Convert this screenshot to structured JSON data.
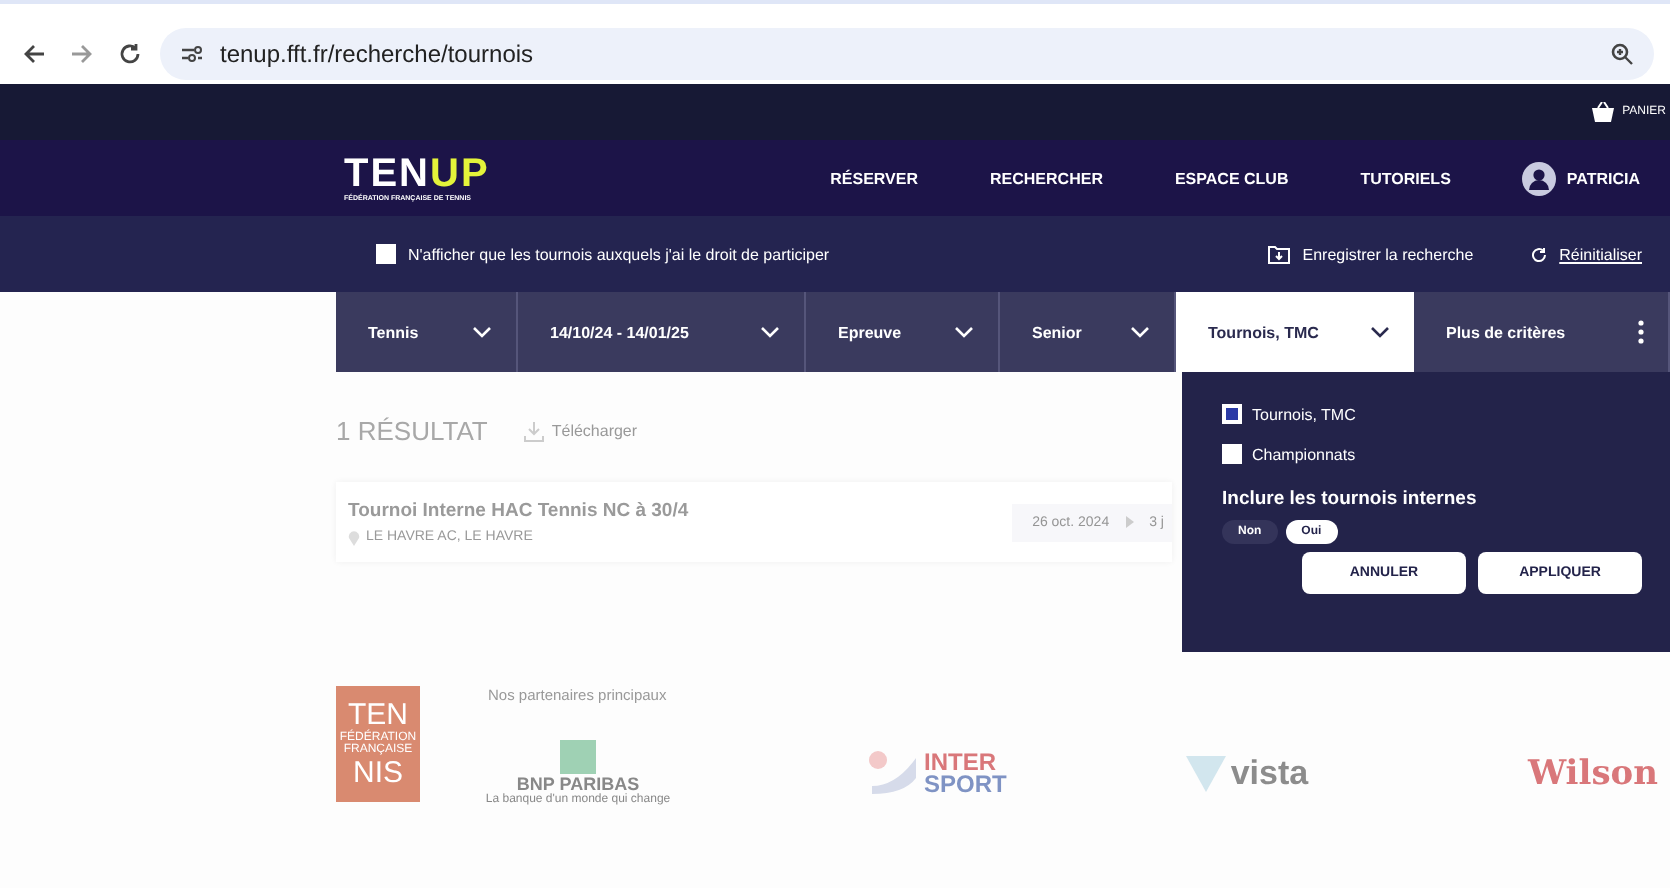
{
  "browser": {
    "url": "tenup.fft.fr/recherche/tournois"
  },
  "top_bar": {
    "cart_label": "PANIER"
  },
  "nav": {
    "logo_left": "TEN",
    "logo_right": "UP",
    "logo_subtitle": "FÉDÉRATION FRANÇAISE DE TENNIS",
    "items": [
      "RÉSERVER",
      "RECHERCHER",
      "ESPACE CLUB",
      "TUTORIELS"
    ],
    "user": "PATRICIA"
  },
  "subbar": {
    "checkbox_label": "N'afficher que les tournois auxquels j'ai le droit de participer",
    "checked": false,
    "save_label": "Enregistrer la recherche",
    "reset_label": "Réinitialiser"
  },
  "filters": [
    {
      "label": "Tennis",
      "selected": false
    },
    {
      "label": "14/10/24 - 14/01/25",
      "selected": false
    },
    {
      "label": "Epreuve",
      "selected": false
    },
    {
      "label": "Senior",
      "selected": false
    },
    {
      "label": "Tournois, TMC",
      "selected": true
    }
  ],
  "more_label": "Plus de critères",
  "results": {
    "count": "1 RÉSULTAT",
    "download": "Télécharger",
    "rows": [
      {
        "title": "Tournoi Interne HAC Tennis NC à 30/4",
        "location": "LE HAVRE AC, LE HAVRE",
        "date": "26 oct. 2024",
        "duration": "3 j"
      }
    ]
  },
  "dropdown": {
    "options": [
      {
        "label": "Tournois, TMC",
        "checked": true
      },
      {
        "label": "Championnats",
        "checked": false
      }
    ],
    "include_label": "Inclure les tournois internes",
    "toggle": [
      {
        "label": "Non",
        "selected": false
      },
      {
        "label": "Oui",
        "selected": true
      }
    ],
    "buttons": [
      "ANNULER",
      "APPLIQUER"
    ]
  },
  "footer": {
    "partners_label": "Nos partenaires principaux",
    "fft_logo": [
      "TEN",
      "FÉDÉRATION FRANÇAISE",
      "NIS"
    ],
    "logos": [
      {
        "kind": "bnp",
        "name": "BNP PARIBAS",
        "tagline": "La banque d'un monde qui change"
      },
      {
        "kind": "intersport",
        "name": "INTER",
        "name2": "SPORT"
      },
      {
        "kind": "vista",
        "name": "vista"
      },
      {
        "kind": "wilson",
        "name": "Wilson"
      }
    ]
  }
}
